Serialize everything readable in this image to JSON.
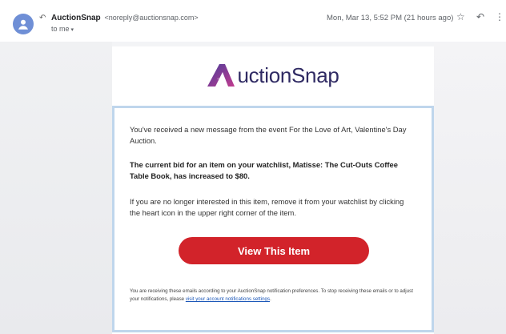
{
  "header": {
    "sender_name": "AuctionSnap",
    "sender_email": "<noreply@auctionsnap.com>",
    "to_me": "to me",
    "timestamp": "Mon, Mar 13, 5:52 PM (21 hours ago)",
    "icons": [
      "back-arrow-icon",
      "star-icon",
      "reply-icon",
      "more-vertical-icon"
    ]
  },
  "email": {
    "logo_text": "uctionSnap",
    "intro": "You've received a new message from the event For the Love of Art, Valentine's Day Auction.",
    "highlight": "The current bid for an item on your watchlist, Matisse: The Cut-Outs Coffee Table Book, has increased to $80.",
    "instruction": "If you are no longer interested in this item, remove it from your watchlist by clicking the heart icon in the upper right corner of the item.",
    "cta_label": "View This Item",
    "footer_text": "You are receiving these emails according to your AuctionSnap notification preferences. To stop receiving these emails or to adjust your notifications, please ",
    "footer_link": "visit your account notifications settings",
    "footer_end": "."
  },
  "colors": {
    "brand_navy": "#2f2a63",
    "cta_red": "#d2232a",
    "frame_blue": "#bfd6ec",
    "avatar_blue": "#6f8fd6"
  }
}
